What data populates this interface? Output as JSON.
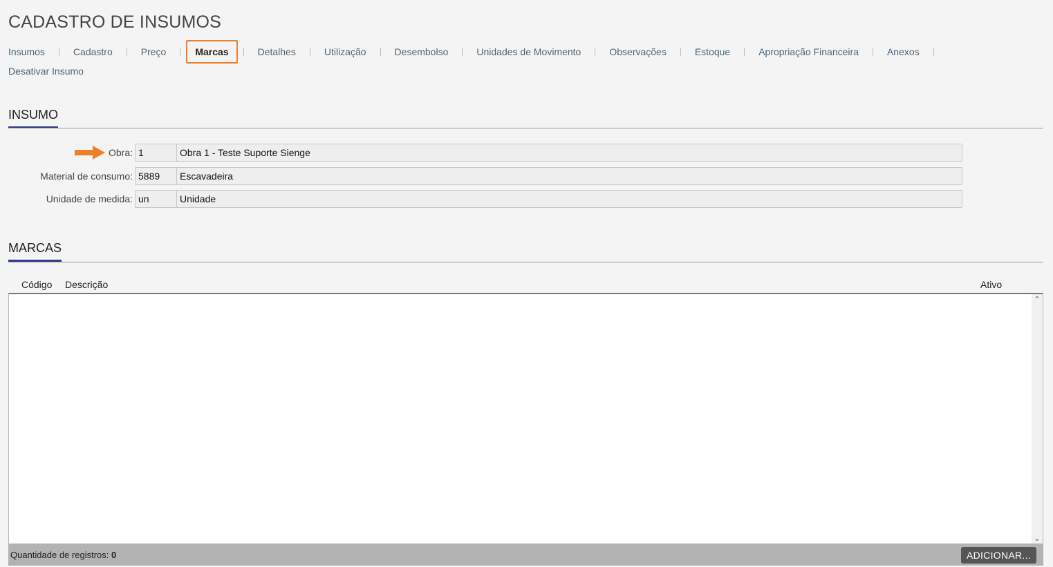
{
  "page": {
    "title": "CADASTRO DE INSUMOS"
  },
  "tabs": {
    "items": [
      {
        "label": "Insumos"
      },
      {
        "label": "Cadastro"
      },
      {
        "label": "Preço"
      },
      {
        "label": "Marcas",
        "active": true
      },
      {
        "label": "Detalhes"
      },
      {
        "label": "Utilização"
      },
      {
        "label": "Desembolso"
      },
      {
        "label": "Unidades de Movimento"
      },
      {
        "label": "Observações"
      },
      {
        "label": "Estoque"
      },
      {
        "label": "Apropriação Financeira"
      },
      {
        "label": "Anexos"
      },
      {
        "label": "Desativar Insumo"
      }
    ]
  },
  "insumo": {
    "title": "INSUMO",
    "fields": [
      {
        "label": "Obra:",
        "code": "1",
        "description": "Obra 1 - Teste Suporte Sienge"
      },
      {
        "label": "Material de consumo:",
        "code": "5889",
        "description": "Escavadeira"
      },
      {
        "label": "Unidade de medida:",
        "code": "un",
        "description": "Unidade"
      }
    ]
  },
  "marcas": {
    "title": "MARCAS",
    "columns": {
      "codigo": "Código",
      "descricao": "Descrição",
      "ativo": "Ativo"
    },
    "rows": [],
    "footer": {
      "count_label": "Quantidade de registros:",
      "count_value": "0",
      "add_label": "ADICIONAR..."
    }
  },
  "colors": {
    "accent_orange": "#f07f2c",
    "section_underline": "#2e3a8c",
    "tab_text": "#4a6478"
  },
  "icons": {
    "pointer_arrow": "arrow-right-icon",
    "scroll_up": "chevron-up-icon",
    "scroll_down": "chevron-down-icon"
  }
}
